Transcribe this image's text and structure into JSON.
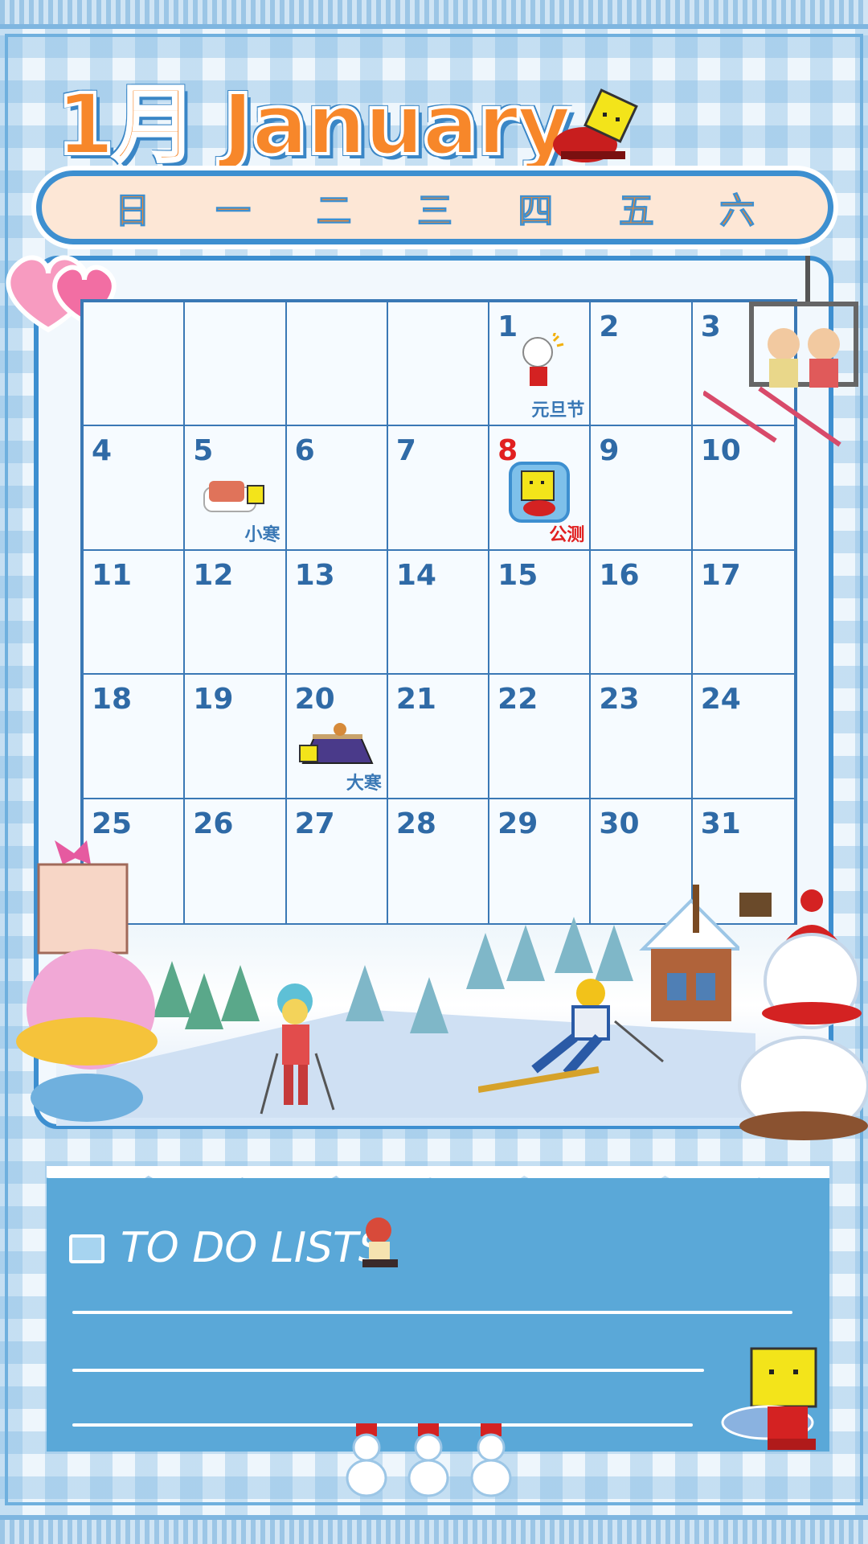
{
  "calendar": {
    "title": "1月 January",
    "weekdays": [
      "日",
      "一",
      "二",
      "三",
      "四",
      "五",
      "六"
    ],
    "days": [
      {
        "n": ""
      },
      {
        "n": ""
      },
      {
        "n": ""
      },
      {
        "n": ""
      },
      {
        "n": "1",
        "event": "元旦节"
      },
      {
        "n": "2"
      },
      {
        "n": "3"
      },
      {
        "n": "4"
      },
      {
        "n": "5",
        "event": "小寒"
      },
      {
        "n": "6"
      },
      {
        "n": "7"
      },
      {
        "n": "8",
        "event": "公测",
        "highlight": "#e12020"
      },
      {
        "n": "9"
      },
      {
        "n": "10"
      },
      {
        "n": "11"
      },
      {
        "n": "12"
      },
      {
        "n": "13"
      },
      {
        "n": "14"
      },
      {
        "n": "15"
      },
      {
        "n": "16"
      },
      {
        "n": "17"
      },
      {
        "n": "18"
      },
      {
        "n": "19"
      },
      {
        "n": "20",
        "event": "大寒"
      },
      {
        "n": "21"
      },
      {
        "n": "22"
      },
      {
        "n": "23"
      },
      {
        "n": "24"
      },
      {
        "n": "25"
      },
      {
        "n": "26"
      },
      {
        "n": "27"
      },
      {
        "n": "28"
      },
      {
        "n": "29"
      },
      {
        "n": "30"
      },
      {
        "n": "31"
      }
    ]
  },
  "todo": {
    "title": "TO DO LISTS",
    "icon": "notepad-icon"
  },
  "colors": {
    "accent_orange": "#f7872a",
    "accent_blue": "#3d8fd0",
    "highlight_red": "#e12020"
  }
}
